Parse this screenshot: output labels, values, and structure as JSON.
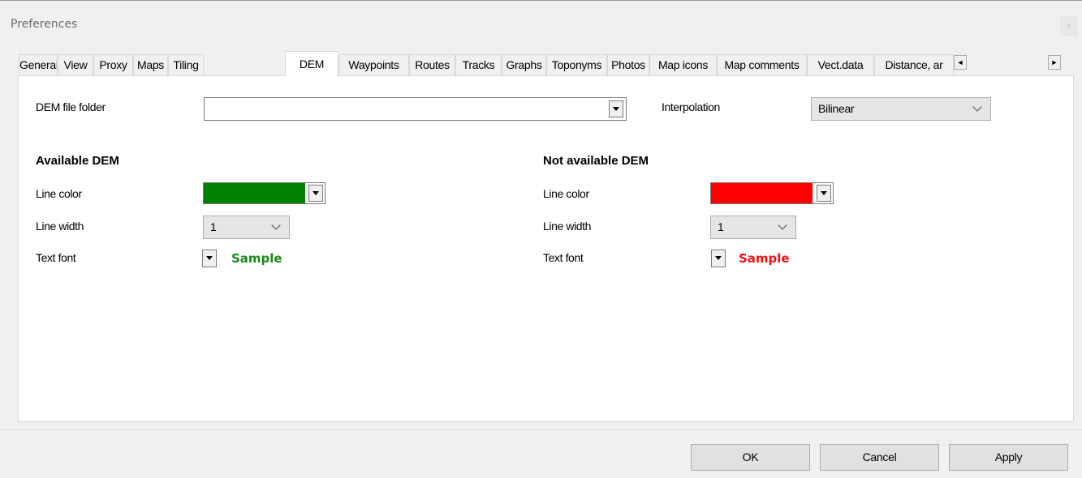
{
  "window": {
    "title": "Preferences",
    "close_glyph": "x"
  },
  "tabs": [
    {
      "label": "General"
    },
    {
      "label": "View"
    },
    {
      "label": "Proxy"
    },
    {
      "label": "Maps"
    },
    {
      "label": "Tiling"
    },
    {
      "label": "DEM",
      "active": true
    },
    {
      "label": "Waypoints"
    },
    {
      "label": "Routes"
    },
    {
      "label": "Tracks"
    },
    {
      "label": "Graphs"
    },
    {
      "label": "Toponyms"
    },
    {
      "label": "Photos"
    },
    {
      "label": "Map icons"
    },
    {
      "label": "Map comments"
    },
    {
      "label": "Vect.data"
    },
    {
      "label": "Distance, ar"
    }
  ],
  "tab_scroll": {
    "left": "◄",
    "right": "►"
  },
  "dem": {
    "folder_label": "DEM file folder",
    "folder_value": "",
    "interpolation_label": "Interpolation",
    "interpolation_value": "Bilinear",
    "available": {
      "header": "Available DEM",
      "line_color_label": "Line color",
      "line_color": "#008000",
      "line_width_label": "Line width",
      "line_width_value": "1",
      "text_font_label": "Text font",
      "sample_text": "Sample",
      "sample_color": "#1a8a1a"
    },
    "not_available": {
      "header": "Not available DEM",
      "line_color_label": "Line color",
      "line_color": "#ff0000",
      "line_width_label": "Line width",
      "line_width_value": "1",
      "text_font_label": "Text font",
      "sample_text": "Sample",
      "sample_color": "#ee1111"
    }
  },
  "buttons": {
    "ok": "OK",
    "cancel": "Cancel",
    "apply": "Apply"
  }
}
